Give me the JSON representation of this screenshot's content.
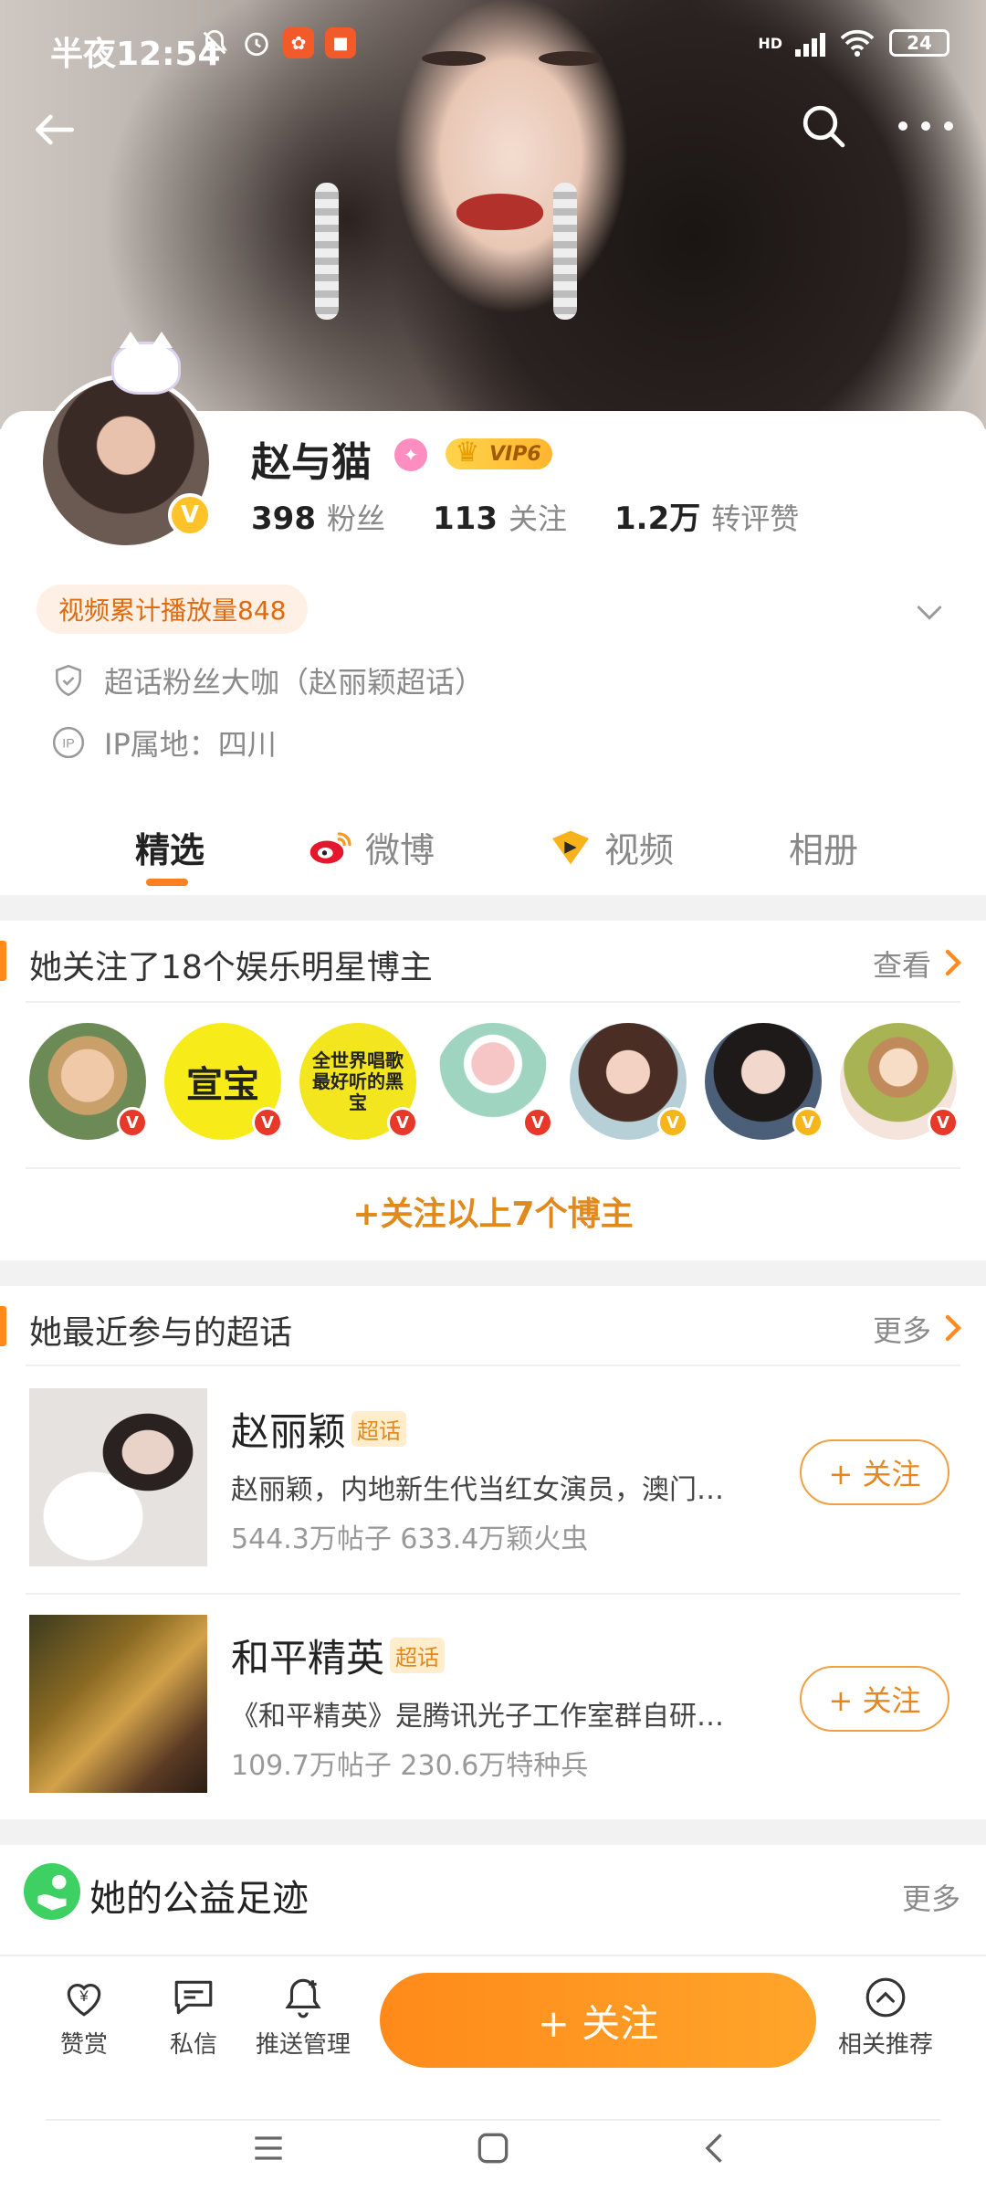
{
  "status": {
    "time": "半夜12:54",
    "hd": "HD",
    "battery": "24",
    "icons": [
      "mute-bell-icon",
      "alarm-icon",
      "app-icon",
      "video-record-icon",
      "signal-icon",
      "wifi-icon",
      "battery-icon"
    ]
  },
  "profile": {
    "name": "赵与猫",
    "vip": "VIP6",
    "verify_badge": "V",
    "stats": [
      {
        "num": "398",
        "label": "粉丝"
      },
      {
        "num": "113",
        "label": "关注"
      },
      {
        "num": "1.2万",
        "label": "转评赞"
      }
    ],
    "play_count": "视频累计播放量848",
    "super_fan": "超话粉丝大咖（赵丽颖超话）",
    "ip": "IP属地：四川"
  },
  "tabs": [
    {
      "label": "精选"
    },
    {
      "label": "微博"
    },
    {
      "label": "视频"
    },
    {
      "label": "相册"
    }
  ],
  "stars_section": {
    "title": "她关注了18个娱乐明星博主",
    "more": "查看",
    "avatar2_text": "宣宝",
    "avatar3_text": "全世界唱歌最好听的黑宝",
    "follow_all": "+关注以上7个博主"
  },
  "topics_section": {
    "title": "她最近参与的超话",
    "more": "更多",
    "items": [
      {
        "name": "赵丽颖",
        "tag": "超话",
        "desc": "赵丽颖，内地新生代当红女演员，澳门…",
        "meta": "544.3万帖子 633.4万颖火虫",
        "button": "+ 关注"
      },
      {
        "name": "和平精英",
        "tag": "超话",
        "desc": "《和平精英》是腾讯光子工作室群自研…",
        "meta": "109.7万帖子 230.6万特种兵",
        "button": "+ 关注"
      }
    ]
  },
  "charity": {
    "title": "她的公益足迹",
    "more": "更多"
  },
  "actionbar": {
    "reward": "赞赏",
    "message": "私信",
    "push": "推送管理",
    "follow": "+ 关注",
    "related": "相关推荐"
  },
  "colors": {
    "accent": "#ff8a1a",
    "vip_gold": "#ffc22b",
    "verify_red": "#e8382a",
    "charity_green": "#3ed063"
  }
}
